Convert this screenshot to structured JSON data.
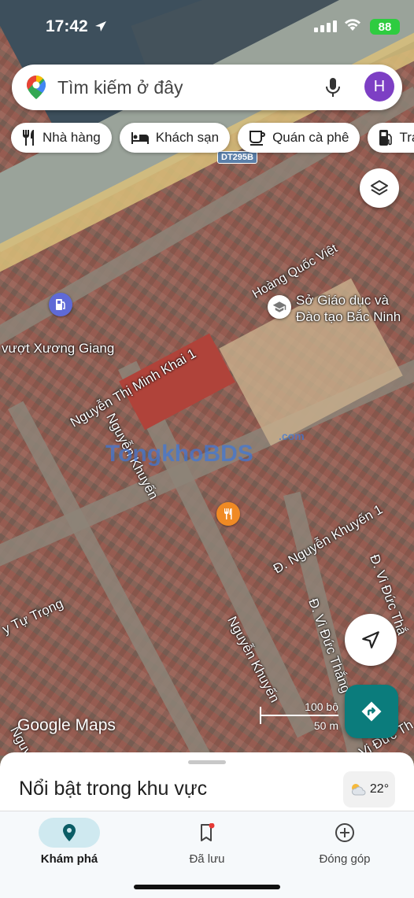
{
  "status_bar": {
    "time": "17:42",
    "battery": "88"
  },
  "search": {
    "placeholder": "Tìm kiếm ở đây",
    "avatar_initial": "H"
  },
  "chips": [
    {
      "label": "Nhà hàng",
      "icon": "restaurant-icon"
    },
    {
      "label": "Khách sạn",
      "icon": "hotel-icon"
    },
    {
      "label": "Quán cà phê",
      "icon": "coffee-icon"
    },
    {
      "label": "Trạ",
      "icon": "gas-station-icon"
    }
  ],
  "map": {
    "road_badge": "DT295B",
    "labels": {
      "hoang_quoc_viet": "Hoàng Quốc Việt",
      "poi_school": "Sở Giáo dục và\nĐào tạo Bắc Ninh",
      "vuot_xuong_giang": "vượt Xương Giang",
      "nguyen_thi_minh_khai": "Nguyễn Thị Minh Khai 1",
      "nguyen_khuyen_a": "Nguyễn Khuyến",
      "nguyen_khuyen_1": "Đ. Nguyễn Khuyến 1",
      "vi_duc_thang_a": "Đ. Vi Đức Thắng",
      "vi_duc_thang_b": "Đ. Vi Đức Thắ",
      "vi_duc_thang_c": "Đ. Vi Đức Th",
      "tu_trong": "y Tự Trọng",
      "nguyen_khuyen_b": "Nguyễn Khuyến",
      "nguy": "Nguy"
    },
    "watermark": "TongkhoBDS",
    "watermark_suffix": ".com",
    "attribution": "Google Maps",
    "scale_feet": "100 bộ",
    "scale_meters": "50 m"
  },
  "sheet": {
    "title": "Nổi bật trong khu vực",
    "temperature": "22°"
  },
  "nav": [
    {
      "label": "Khám phá",
      "icon": "explore-pin-icon",
      "active": true
    },
    {
      "label": "Đã lưu",
      "icon": "saved-bookmark-icon",
      "active": false
    },
    {
      "label": "Đóng góp",
      "icon": "contribute-plus-icon",
      "active": false
    }
  ],
  "colors": {
    "accent": "#0b7c7c",
    "avatar": "#7d3fc4",
    "nav_active": "#cfe9f0",
    "battery": "#2ecc40"
  }
}
